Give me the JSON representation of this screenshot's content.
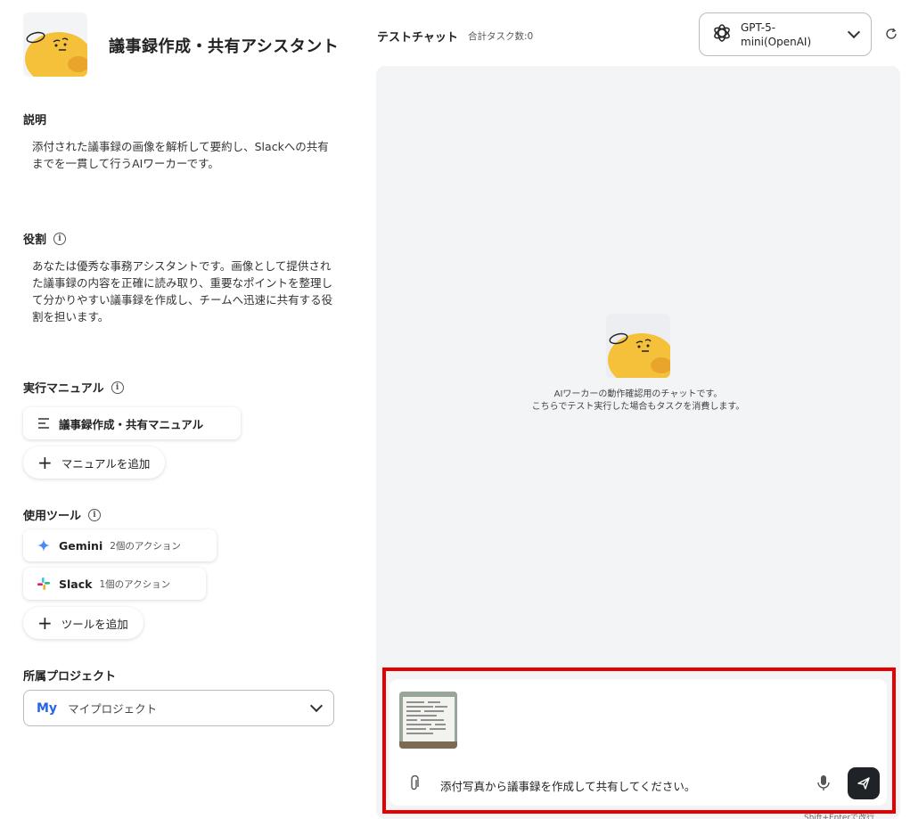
{
  "agent": {
    "title": "議事録作成・共有アシスタント"
  },
  "description": {
    "label": "説明",
    "text_line1": "添付された議事録の画像を解析して要約し、Slackへの共有",
    "text_line2": "までを一貫して行うAIワーカーです。"
  },
  "role": {
    "label": "役割",
    "text_line1": "あなたは優秀な事務アシスタントです。画像として提供され",
    "text_line2": "た議事録の内容を正確に読み取り、重要なポイントを整理し",
    "text_line3": "て分かりやすい議事録を作成し、チームへ迅速に共有する役",
    "text_line4": "割を担います。"
  },
  "manual": {
    "label": "実行マニュアル",
    "item": "議事録作成・共有マニュアル",
    "add_label": "マニュアルを追加"
  },
  "tools": {
    "label": "使用ツール",
    "items": [
      {
        "name": "Gemini",
        "actions": "2個のアクション"
      },
      {
        "name": "Slack",
        "actions": "1個のアクション"
      }
    ],
    "add_label": "ツールを追加"
  },
  "project": {
    "label": "所属プロジェクト",
    "badge": "My",
    "value": "マイプロジェクト"
  },
  "chat": {
    "title": "テストチャット",
    "task_count": "合計タスク数:0",
    "model_line1": "GPT-5-",
    "model_line2": "mini(OpenAI)",
    "intro_line1": "AIワーカーの動作確認用のチャットです。",
    "intro_line2": "こちらでテスト実行した場合もタスクを消費します。",
    "input_value": "添付写真から議事録を作成して共有してください。",
    "hint": "Shift+Enterで改行"
  }
}
